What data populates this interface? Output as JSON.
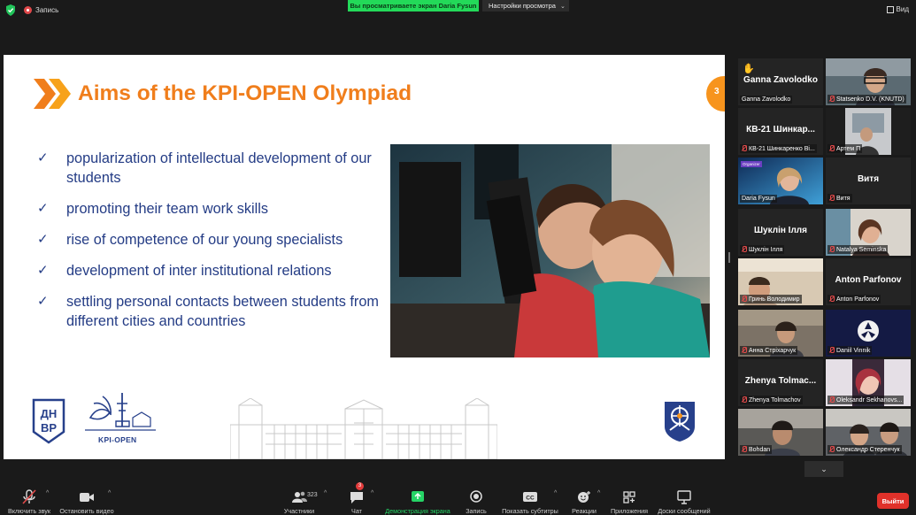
{
  "topbar": {
    "recording_label": "Запись",
    "share_banner": "Вы просматриваете экран Daria Fysun",
    "view_settings": "Настройки просмотра",
    "view_label": "Вид"
  },
  "slide": {
    "title": "Aims of the KPI-OPEN Olympiad",
    "page_number": "3",
    "bullets": [
      "popularization of intellectual development of our students",
      "promoting their team work skills",
      "rise of competence of our young specialists",
      "development of inter institutional relations",
      "settling personal contacts between students from different cities and countries"
    ],
    "logo_dnvr_text": "ДН ВР",
    "logo_kpi_text": "KPI-OPEN"
  },
  "participants": [
    {
      "big": "Ganna Zavolodko",
      "label": "Ganna Zavolodko",
      "kind": "name",
      "hand": true
    },
    {
      "big": "",
      "label": "Statsenko D.V. (KNUTD)",
      "kind": "video"
    },
    {
      "big": "КВ-21 Шинкар...",
      "label": "КВ-21 Шинкаренко Ві...",
      "kind": "name"
    },
    {
      "big": "",
      "label": "Артем П",
      "kind": "video"
    },
    {
      "big": "",
      "label": "Daria Fysun",
      "kind": "video",
      "active": true,
      "badge": "Organizer"
    },
    {
      "big": "Витя",
      "label": "Витя",
      "kind": "name"
    },
    {
      "big": "Шуклін Ілля",
      "label": "Шуклін Ілля",
      "kind": "name"
    },
    {
      "big": "",
      "label": "Natalya Seminska",
      "kind": "video"
    },
    {
      "big": "",
      "label": "Гринь Володимир",
      "kind": "video"
    },
    {
      "big": "Anton Parfonov",
      "label": "Anton Parfonov",
      "kind": "name"
    },
    {
      "big": "",
      "label": "Анна Стрiхарчук",
      "kind": "video"
    },
    {
      "big": "",
      "label": "Daniil Vinnik",
      "kind": "video"
    },
    {
      "big": "Zhenya Tolmac...",
      "label": "Zhenya Tolmachov",
      "kind": "name"
    },
    {
      "big": "",
      "label": "Oleksandr Sekhanovs...",
      "kind": "video"
    },
    {
      "big": "",
      "label": "Bohdan",
      "kind": "video"
    },
    {
      "big": "",
      "label": "Олександр Стеренчук",
      "kind": "video"
    }
  ],
  "toolbar": {
    "audio": "Включить звук",
    "video": "Остановить видео",
    "participants": "Участники",
    "participants_count": "323",
    "chat": "Чат",
    "chat_badge": "3",
    "share": "Демонстрация экрана",
    "record": "Запись",
    "captions": "Показать субтитры",
    "reactions": "Реакции",
    "apps": "Приложения",
    "whiteboards": "Доски сообщений",
    "leave": "Выйти"
  },
  "colors": {
    "accent_orange": "#f07e1c",
    "slide_text": "#243c85",
    "share_green": "#23d959",
    "leave_red": "#e0312a"
  }
}
